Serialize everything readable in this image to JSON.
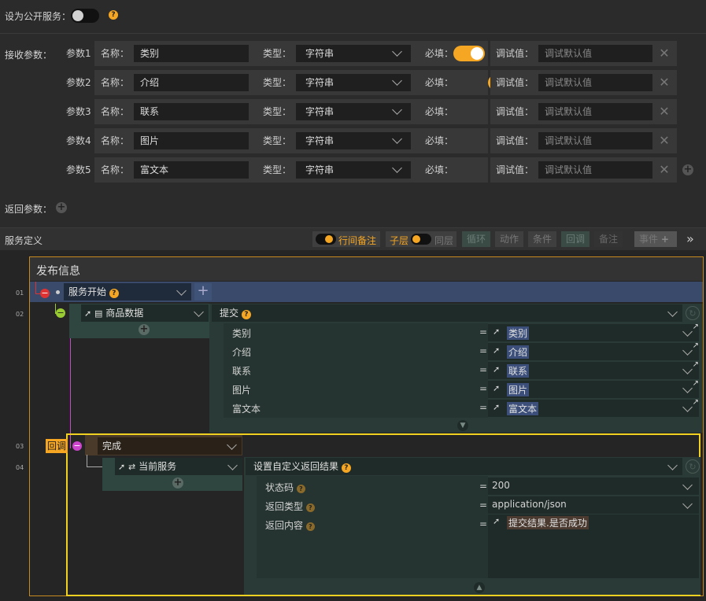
{
  "public_service": {
    "label": "设为公开服务：",
    "help": "?"
  },
  "receive": {
    "label": "接收参数：",
    "name_label": "名称：",
    "type_label": "类型：",
    "required_label": "必填：",
    "debug_label": "调试值：",
    "params": [
      {
        "id": "参数1",
        "name": "类别",
        "type": "字符串",
        "required": true,
        "debug_placeholder": "调试默认值"
      },
      {
        "id": "参数2",
        "name": "介绍",
        "type": "字符串",
        "required": true,
        "debug_placeholder": "调试默认值"
      },
      {
        "id": "参数3",
        "name": "联系",
        "type": "字符串",
        "required": true,
        "debug_placeholder": "调试默认值"
      },
      {
        "id": "参数4",
        "name": "图片",
        "type": "字符串",
        "required": true,
        "debug_placeholder": "调试默认值"
      },
      {
        "id": "参数5",
        "name": "富文本",
        "type": "字符串",
        "required": true,
        "debug_placeholder": "调试默认值"
      }
    ]
  },
  "return_params": {
    "label": "返回参数："
  },
  "service_def": {
    "label": "服务定义",
    "toolbar": {
      "inline_note": "行间备注",
      "sublayer": "子层",
      "samelayer": "同层",
      "loop": "循环",
      "action": "动作",
      "condition": "条件",
      "callback": "回调",
      "note": "备注",
      "event": "事件",
      "more": "»"
    }
  },
  "flow": {
    "panel_title": "发布信息",
    "line_numbers": [
      "01",
      "02",
      "03",
      "04"
    ],
    "service_start": "服务开始",
    "goods_data": "商品数据",
    "submit": "提交",
    "fields": [
      {
        "name": "类别",
        "value": "类别"
      },
      {
        "name": "介绍",
        "value": "介绍"
      },
      {
        "name": "联系",
        "value": "联系"
      },
      {
        "name": "图片",
        "value": "图片"
      },
      {
        "name": "富文本",
        "value": "富文本"
      }
    ],
    "eq": "=",
    "callback_tag": "回调",
    "done": "完成",
    "current_service": "当前服务",
    "set_result": "设置自定义返回结果",
    "result_fields": [
      {
        "name": "状态码",
        "value": "200"
      },
      {
        "name": "返回类型",
        "value": "application/json"
      },
      {
        "name": "返回内容",
        "value": "提交结果.是否成功"
      }
    ]
  }
}
